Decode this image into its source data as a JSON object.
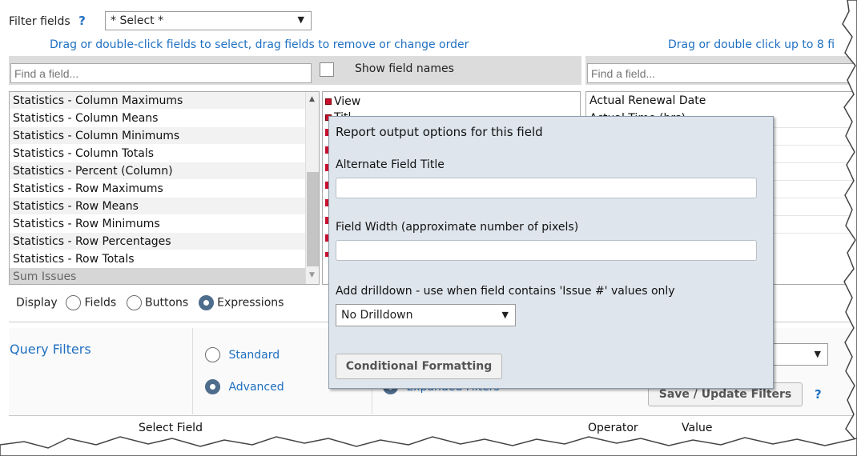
{
  "filter": {
    "label": "Filter fields",
    "help": "?",
    "select_value": "* Select *"
  },
  "hints": {
    "left": "Drag or double-click fields to select, drag fields to remove or change order",
    "right": "Drag or double click up to 8 fi"
  },
  "left_search": {
    "placeholder": "Find a field..."
  },
  "show_field_names": "Show field names",
  "right_search": {
    "placeholder": "Find a field..."
  },
  "left_list": [
    "Statistics - Column Maximums",
    "Statistics - Column Means",
    "Statistics - Column Minimums",
    "Statistics - Column Totals",
    "Statistics - Percent (Column)",
    "Statistics - Row Maximums",
    "Statistics - Row Means",
    "Statistics - Row Minimums",
    "Statistics - Row Percentages",
    "Statistics - Row Totals",
    "Sum Issues"
  ],
  "middle_list": [
    "View",
    "Titl"
  ],
  "right_list": [
    "Actual Renewal Date",
    "Actual Time (hrs)"
  ],
  "display": {
    "label": "Display",
    "options": [
      "Fields",
      "Buttons",
      "Expressions"
    ],
    "selected": "Expressions"
  },
  "query_filters": {
    "title": "Query Filters",
    "standard": "Standard",
    "advanced": "Advanced",
    "expanded": "Expanded Filters",
    "save_button": "Save / Update Filters",
    "help": "?"
  },
  "columns": {
    "select_field": "Select Field",
    "operator": "Operator",
    "value": "Value"
  },
  "popup": {
    "title": "Report output options for this field",
    "alt_title_label": "Alternate Field Title",
    "alt_title_value": "",
    "width_label": "Field Width (approximate number of pixels)",
    "width_value": "",
    "drilldown_label": "Add drilldown - use when field contains 'Issue #' values only",
    "drilldown_value": "No Drilldown",
    "conditional_button": "Conditional Formatting"
  },
  "colors": {
    "accent_blue": "#1f70c1",
    "popup_bg": "#dfe5ec",
    "radio_on": "#4e6d8c"
  }
}
